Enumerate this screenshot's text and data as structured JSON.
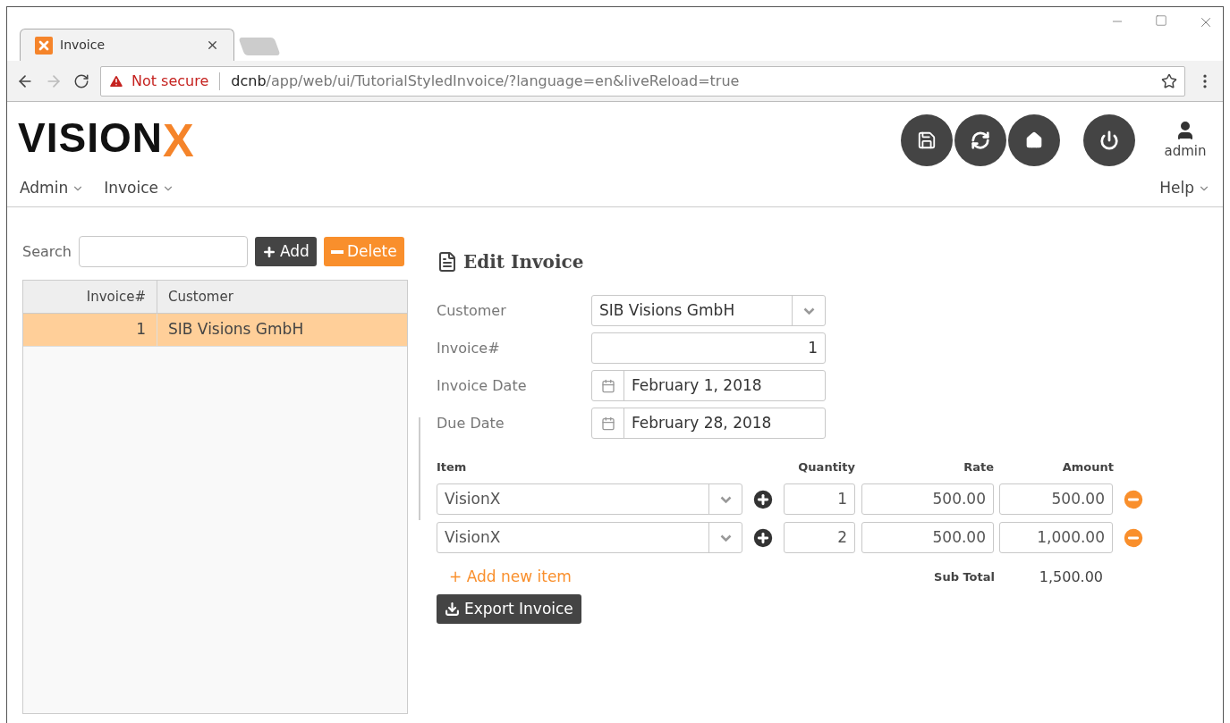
{
  "browser": {
    "tabs": [
      {
        "title": "Invoice",
        "selected": true
      }
    ],
    "nav": {
      "forward_disabled": true
    },
    "security": "Not secure",
    "url_host": "dcnb",
    "url_path": "/app/web/ui/TutorialStyledInvoice/?language=en&liveReload=true"
  },
  "app": {
    "logo": {
      "text": "VISION",
      "accent": "X"
    },
    "user": "admin",
    "menu": [
      {
        "label": "Admin"
      },
      {
        "label": "Invoice"
      }
    ],
    "help_menu": "Help"
  },
  "list_panel": {
    "search_label": "Search",
    "add_button": "Add",
    "delete_button": "Delete",
    "table": {
      "columns": [
        "Invoice#",
        "Customer"
      ],
      "rows": [
        {
          "cells": [
            "1",
            "SIB Visions GmbH"
          ],
          "selected": true
        }
      ]
    }
  },
  "form": {
    "title": "Edit Invoice",
    "fields": [
      {
        "label": "Customer",
        "kind": "select",
        "value": "SIB Visions GmbH"
      },
      {
        "label": "Invoice#",
        "kind": "number",
        "value": "1"
      },
      {
        "label": "Invoice Date",
        "kind": "date",
        "value": "February 1, 2018"
      },
      {
        "label": "Due Date",
        "kind": "date",
        "value": "February 28, 2018"
      }
    ],
    "items_columns": [
      "Item",
      "Quantity",
      "Rate",
      "Amount"
    ],
    "items": [
      {
        "item": "VisionX",
        "quantity": "1",
        "rate": "500.00",
        "amount": "500.00"
      },
      {
        "item": "VisionX",
        "quantity": "2",
        "rate": "500.00",
        "amount": "1,000.00"
      }
    ],
    "add_item": "+ Add new item",
    "subtotal_label": "Sub Total",
    "subtotal": "1,500.00",
    "export_button": "Export Invoice"
  }
}
